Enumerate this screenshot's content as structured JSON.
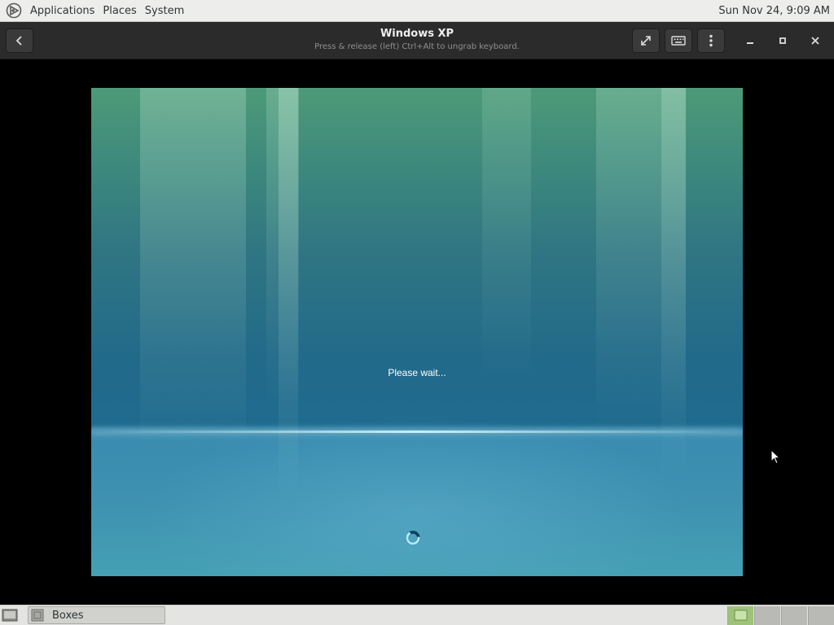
{
  "top_panel": {
    "menus": [
      "Applications",
      "Places",
      "System"
    ],
    "clock": "Sun Nov 24,  9:09 AM"
  },
  "headerbar": {
    "title": "Windows XP",
    "subtitle": "Press & release (left) Ctrl+Alt to ungrab keyboard.",
    "icons": [
      "back-arrow-icon",
      "fullscreen-icon",
      "keyboard-icon",
      "menu-dots-icon",
      "minimize-icon",
      "maximize-icon",
      "close-icon"
    ]
  },
  "vm": {
    "status_text": "Please wait..."
  },
  "taskbar": {
    "window_button": "Boxes",
    "workspaces": 4,
    "active_workspace": 1
  },
  "colors": {
    "panel_bg": "#edeeec",
    "headerbar_bg": "#2b2b2b",
    "vm_top": "#4d9a78",
    "vm_bottom": "#44a0b4"
  }
}
